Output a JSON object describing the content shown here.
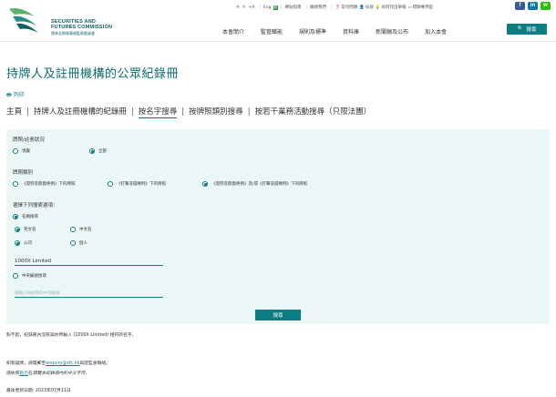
{
  "logo": {
    "name_en_line1": "SECURITIES AND",
    "name_en_line2": "FUTURES COMMISSION",
    "name_zh": "證券及期貨事務監察委員會"
  },
  "utility": {
    "font_sizes": [
      "-A",
      "A",
      "+A"
    ],
    "language": "Eng",
    "items": [
      {
        "icon": "sitemap-icon",
        "label": "網站指南"
      },
      {
        "icon": "contact-icon",
        "label": "聯絡我們"
      },
      {
        "icon": "question-icon",
        "label": "常見問題"
      },
      {
        "icon": "user-icon",
        "label": "投訴"
      },
      {
        "icon": "bulb-icon",
        "label": "如何作出舉報"
      },
      {
        "icon": "monitor-icon",
        "label": "標題專用區"
      }
    ],
    "green_tag": "新"
  },
  "social": [
    "f",
    "in",
    "w"
  ],
  "nav": {
    "items": [
      "本會簡介",
      "監管職能",
      "規則及標準",
      "資料庫",
      "新聞稿及公布",
      "加入本會"
    ],
    "search_label": "搜尋"
  },
  "page": {
    "title": "持牌人及註冊機構的公眾紀錄冊",
    "print_label": "列印",
    "tabs": {
      "home": "主頁",
      "register": "持牌人及註冊機構的紀錄冊",
      "by_name": "按名字搜尋",
      "by_license_type": "按牌照類別搜尋",
      "by_business": "按若干業務活動搜尋（只限法團）"
    }
  },
  "form": {
    "status_label": "牌照/註冊狀況",
    "status_options": [
      "現屬",
      "全部"
    ],
    "status_selected": "全部",
    "license_label": "牌照類別",
    "license_options": [
      "《證券及期貨條例》下的牌照",
      "《打擊洗錢條例》下的牌照",
      "《證券及期貨條例》及/或《打擊洗錢條例》下的牌照"
    ],
    "criteria_label": "選擇下列搜索選項：",
    "search_type": "名稱搜尋",
    "name_lang_options": [
      "英文名",
      "中文名"
    ],
    "entity_options": [
      "公司",
      "個人"
    ],
    "name_value": "1000X Limited",
    "ce_option": "中央編號搜尋",
    "ce_placeholder": "請輸入你搜尋的中央編號",
    "submit_label": "搜尋"
  },
  "results": {
    "message": "對不起，紀錄冊內沒有與你所輸入 (1000X Limited) 相符的名字。"
  },
  "footer": {
    "enquiry_prefix": "如有疑問，請電郵至",
    "enquiry_email": "enquiry@sfc.hk",
    "enquiry_suffix": "與證監會聯絡。",
    "guide_prefix": "請依照",
    "guide_link": "指示",
    "guide_mid": "在",
    "guide_suffix": "閱覽本紀錄冊內的中文字符。",
    "updated": "最後更新日期: 2023年07月11日"
  }
}
